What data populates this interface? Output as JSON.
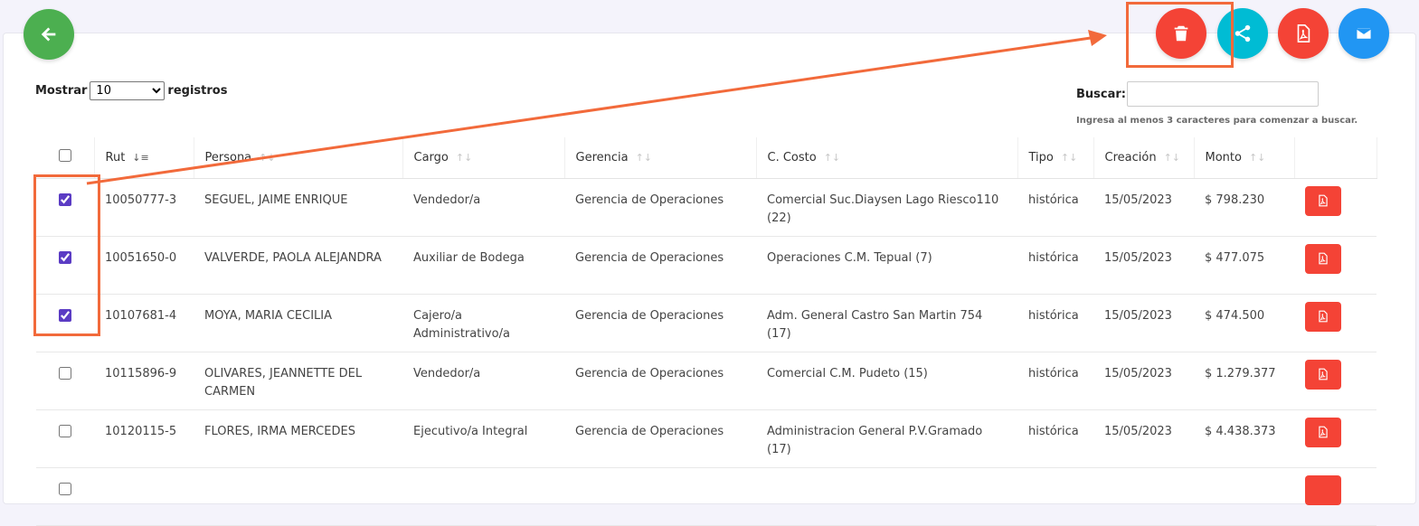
{
  "toolbar": {
    "back": "arrow-left-icon",
    "delete": "trash-icon",
    "share": "share-icon",
    "pdf": "pdf-icon",
    "mail": "envelope-icon"
  },
  "length": {
    "label_before": "Mostrar",
    "selected": "10",
    "label_after": "registros"
  },
  "search": {
    "label": "Buscar:",
    "value": "",
    "hint": "Ingresa al menos 3 caracteres para comenzar a buscar."
  },
  "table": {
    "headers": [
      "Rut",
      "Persona",
      "Cargo",
      "Gerencia",
      "C. Costo",
      "Tipo",
      "Creación",
      "Monto"
    ],
    "rows": [
      {
        "checked": true,
        "rut": "10050777-3",
        "persona": "SEGUEL, JAIME ENRIQUE",
        "cargo": "Vendedor/a",
        "gerencia": "Gerencia de Operaciones",
        "costo": "Comercial Suc.Diaysen Lago Riesco110 (22)",
        "tipo": "histórica",
        "creacion": "15/05/2023",
        "monto": "$ 798.230"
      },
      {
        "checked": true,
        "rut": "10051650-0",
        "persona": "VALVERDE, PAOLA ALEJANDRA",
        "cargo": "Auxiliar de Bodega",
        "gerencia": "Gerencia de Operaciones",
        "costo": "Operaciones C.M. Tepual (7)",
        "tipo": "histórica",
        "creacion": "15/05/2023",
        "monto": "$ 477.075"
      },
      {
        "checked": true,
        "rut": "10107681-4",
        "persona": "MOYA, MARIA CECILIA",
        "cargo": "Cajero/a Administrativo/a",
        "gerencia": "Gerencia de Operaciones",
        "costo": "Adm. General Castro San Martin 754 (17)",
        "tipo": "histórica",
        "creacion": "15/05/2023",
        "monto": "$ 474.500"
      },
      {
        "checked": false,
        "rut": "10115896-9",
        "persona": "OLIVARES, JEANNETTE DEL CARMEN",
        "cargo": "Vendedor/a",
        "gerencia": "Gerencia de Operaciones",
        "costo": "Comercial C.M. Pudeto (15)",
        "tipo": "histórica",
        "creacion": "15/05/2023",
        "monto": "$ 1.279.377"
      },
      {
        "checked": false,
        "rut": "10120115-5",
        "persona": "FLORES, IRMA MERCEDES",
        "cargo": "Ejecutivo/a Integral",
        "gerencia": "Gerencia de Operaciones",
        "costo": "Administracion General P.V.Gramado (17)",
        "tipo": "histórica",
        "creacion": "15/05/2023",
        "monto": "$ 4.438.373"
      }
    ]
  },
  "colors": {
    "annotation": "#f26a3b",
    "delete": "#f44336",
    "share": "#00bcd4",
    "mail": "#2196f3",
    "back": "#4caf50"
  }
}
